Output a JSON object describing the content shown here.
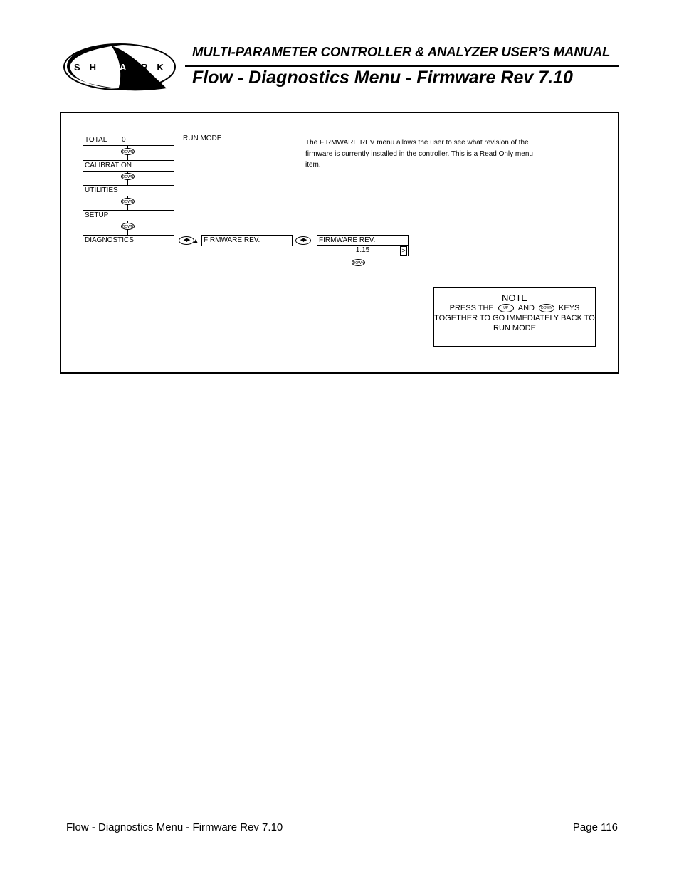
{
  "header": {
    "logo_text": "S H A R K",
    "manual_title": "MULTI-PARAMETER CONTROLLER & ANALYZER USER’S MANUAL",
    "page_title": "Flow - Diagnostics Menu - Firmware Rev 7.10"
  },
  "diagram": {
    "run_mode_label": "RUN MODE",
    "menu_items": [
      {
        "label": "TOTAL",
        "value": "0"
      },
      {
        "label": "CALIBRATION"
      },
      {
        "label": "UTILITIES"
      },
      {
        "label": "SETUP"
      },
      {
        "label": "DIAGNOSTICS"
      }
    ],
    "down_key_label": "DOWN",
    "up_key_label": "UP",
    "left_right_key": "◀▶",
    "firmware_menu_label": "FIRMWARE REV.",
    "firmware_screen_label": "FIRMWARE REV.",
    "firmware_value": "1.15",
    "value_arrow": ">",
    "description": "The FIRMWARE REV menu allows the user to see what revision of the firmware is currently installed in the controller.  This is a Read Only menu item."
  },
  "note": {
    "title": "NOTE",
    "line1_pre": "PRESS THE",
    "line1_mid": "AND",
    "line1_post": "KEYS",
    "line2": "TOGETHER TO GO IMMEDIATELY BACK TO",
    "line3": "RUN MODE"
  },
  "footer": {
    "left": "Flow - Diagnostics Menu - Firmware Rev 7.10",
    "right": "Page 116"
  }
}
